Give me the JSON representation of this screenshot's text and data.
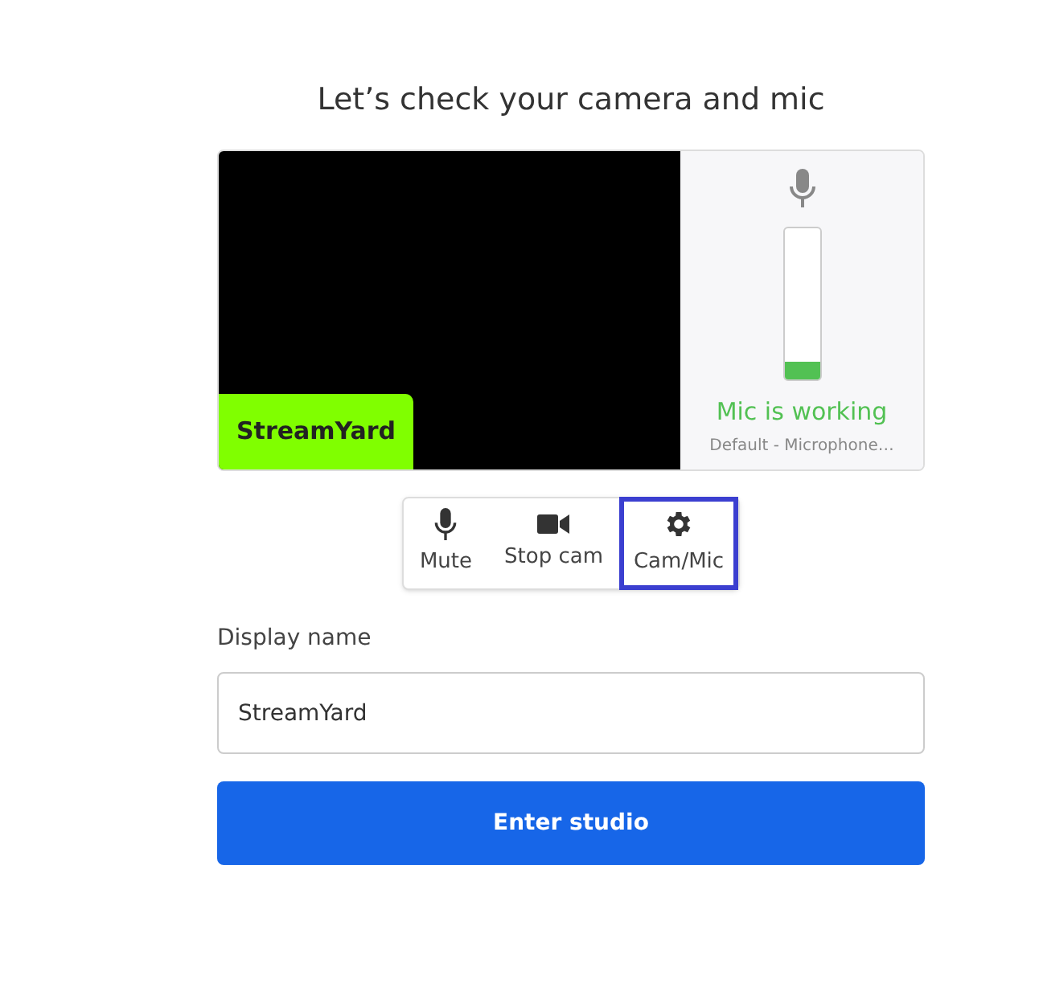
{
  "heading": "Let’s check your camera and mic",
  "preview": {
    "name_tag": "StreamYard"
  },
  "mic_panel": {
    "level": 0.12,
    "status": "Mic is working",
    "device": "Default - Microphone…"
  },
  "controls": [
    {
      "kind": "mic",
      "label": "Mute",
      "selected": false
    },
    {
      "kind": "camera",
      "label": "Stop cam",
      "selected": false
    },
    {
      "kind": "gear",
      "label": "Cam/Mic",
      "selected": true
    }
  ],
  "display_name": {
    "label": "Display name",
    "value": "StreamYard"
  },
  "enter_button": "Enter studio"
}
